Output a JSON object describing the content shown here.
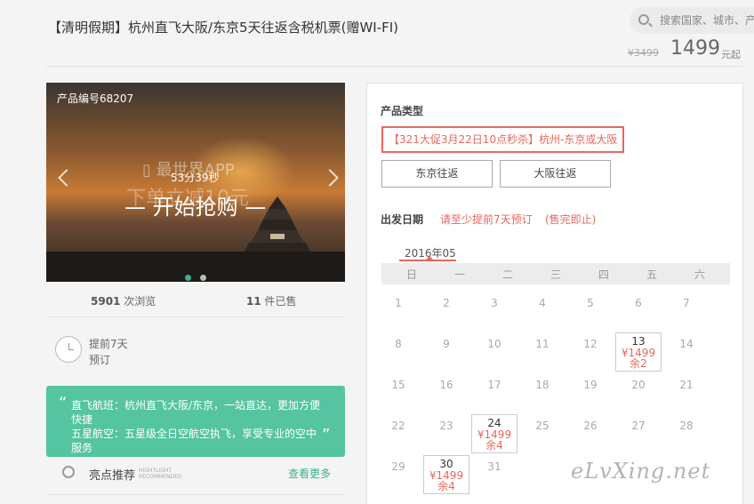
{
  "header": {
    "title": "【清明假期】杭州直飞大阪/东京5天往返含税机票(赠WI-FI)",
    "search_placeholder": "搜索国家、城市、产品",
    "original_price": "¥3499",
    "price": "1499",
    "price_suffix": "元起"
  },
  "hero": {
    "product_code": "产品编号68207",
    "app_text": "▯ 最世界APP",
    "ghost_text": "下单立减10元",
    "countdown": "53分39秒",
    "cta": "— 开始抢购 —",
    "slides": 2,
    "active_slide": 1
  },
  "stats": {
    "views_count": "5901",
    "views_label": "次浏览",
    "sold_count": "11",
    "sold_label": "件已售"
  },
  "advance": {
    "line1": "提前7天",
    "line2": "预订"
  },
  "highlight": {
    "lines": [
      "直飞航班：杭州直飞大阪/东京，一站直达，更加方便快捷",
      "五星航空：五星级全日空航空执飞，享受专业的空中服务"
    ]
  },
  "recommend": {
    "label": "亮点推荐",
    "en_line1": "HIGHTLIGHT",
    "en_line2": "RECOMMENDED",
    "more": "查看更多"
  },
  "booking": {
    "type_label": "产品类型",
    "promo": "【321大促3月22日10点秒杀】杭州-东京或大阪",
    "routes": [
      "东京往返",
      "大阪往返"
    ],
    "departure_label": "出发日期",
    "advance_note": "请至少提前7天预订",
    "sellout_note": "(售完即止)",
    "month": "2016年05",
    "weekdays": [
      "日",
      "一",
      "二",
      "三",
      "四",
      "五",
      "六"
    ],
    "weeks": [
      [
        {
          "d": "1"
        },
        {
          "d": "2"
        },
        {
          "d": "3"
        },
        {
          "d": "4"
        },
        {
          "d": "5"
        },
        {
          "d": "6"
        },
        {
          "d": "7"
        }
      ],
      [
        {
          "d": "8"
        },
        {
          "d": "9"
        },
        {
          "d": "10"
        },
        {
          "d": "11"
        },
        {
          "d": "12"
        },
        {
          "d": "13",
          "price": "¥1499",
          "stock": "余2"
        },
        {
          "d": "14"
        }
      ],
      [
        {
          "d": "15"
        },
        {
          "d": "16"
        },
        {
          "d": "17"
        },
        {
          "d": "18"
        },
        {
          "d": "19"
        },
        {
          "d": "20"
        },
        {
          "d": "21"
        }
      ],
      [
        {
          "d": "22"
        },
        {
          "d": "23"
        },
        {
          "d": "24",
          "price": "¥1499",
          "stock": "余4"
        },
        {
          "d": "25"
        },
        {
          "d": "26"
        },
        {
          "d": "27"
        },
        {
          "d": "28"
        }
      ],
      [
        {
          "d": "29"
        },
        {
          "d": "30",
          "price": "¥1499",
          "stock": "余4"
        },
        {
          "d": "31"
        }
      ]
    ]
  },
  "watermark": "eLvXing.net",
  "colors": {
    "accent_green": "#55c4a0",
    "accent_red": "#e8675c"
  }
}
